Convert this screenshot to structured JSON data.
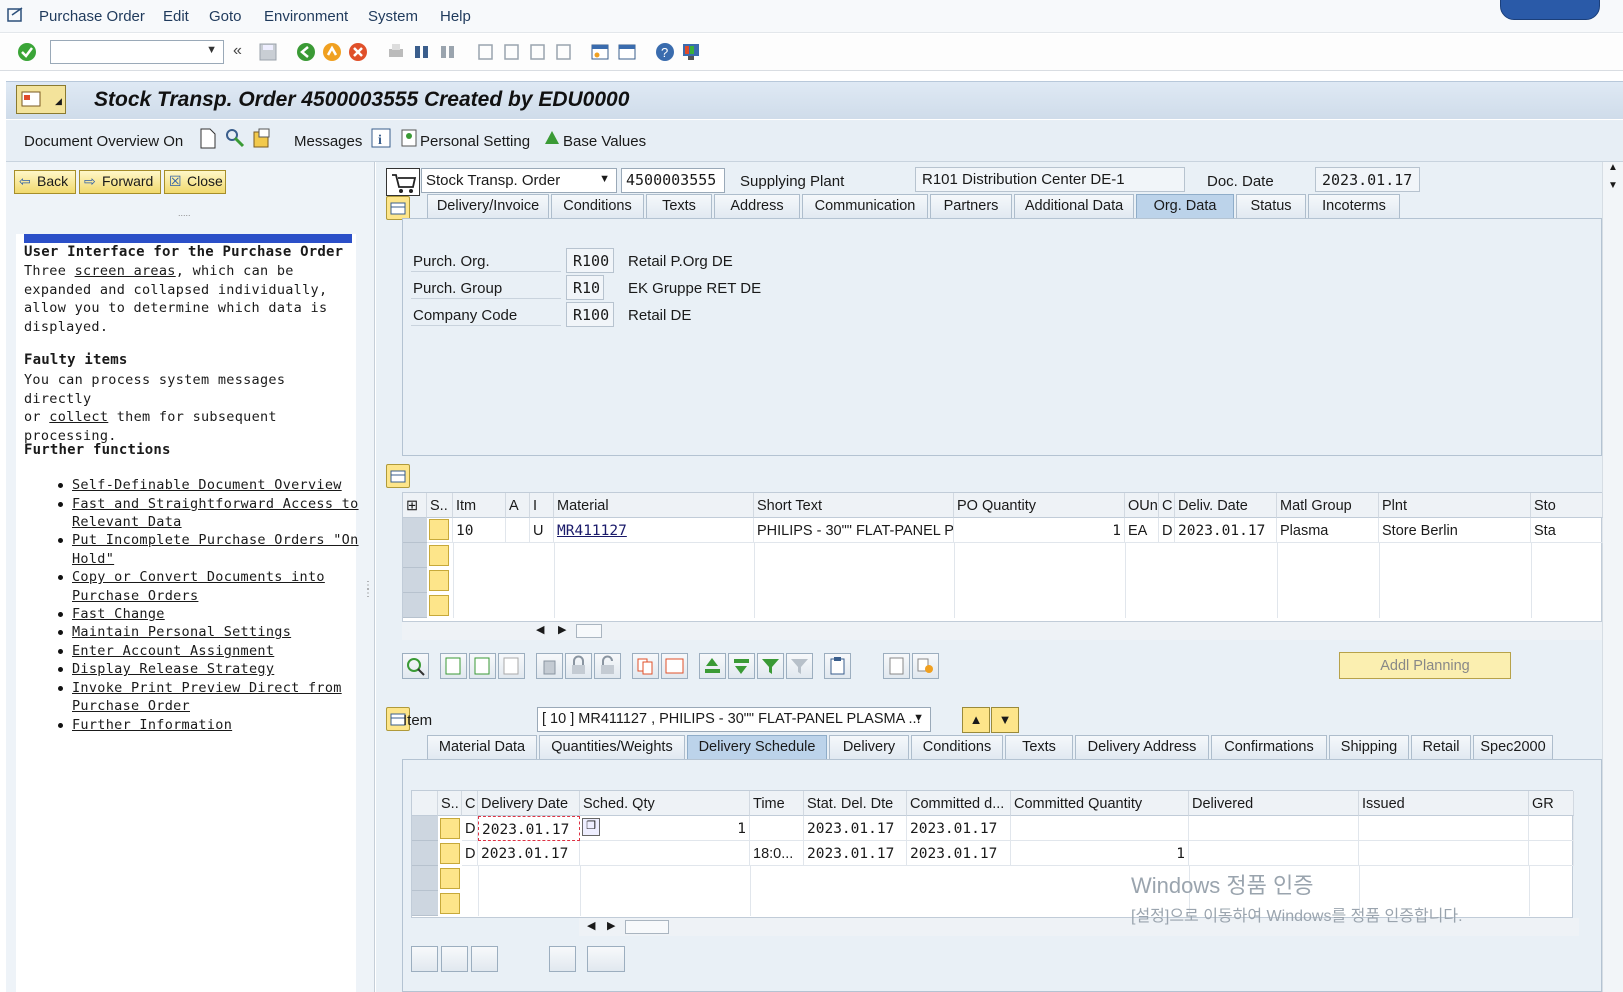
{
  "menubar": {
    "items": [
      "Purchase Order",
      "Edit",
      "Goto",
      "Environment",
      "System",
      "Help"
    ]
  },
  "toolbar": {
    "command_placeholder": ""
  },
  "title": "Stock Transp. Order 4500003555 Created by EDU0000",
  "appbar": {
    "doc_overview": "Document Overview On",
    "messages": "Messages",
    "personal_setting": "Personal Setting",
    "base_values": "Base Values"
  },
  "nav": {
    "back": "Back",
    "forward": "Forward",
    "close": "Close"
  },
  "help": {
    "h1": "User Interface for the Purchase Order",
    "p1a": "Three ",
    "p1link": "screen areas",
    "p1b": ", which can be",
    "p1c": "expanded and collapsed individually,",
    "p1d": "allow you to determine which data is",
    "p1e": "displayed.",
    "h2": "Faulty items",
    "p2a": "You can process system messages directly",
    "p2b": "or ",
    "p2link": "collect",
    "p2c": " them for subsequent",
    "p2d": "processing.",
    "h3": "Further functions",
    "links": [
      "Self-Definable Document Overview",
      "Fast and Straightforward Access to",
      "Relevant Data",
      "Put Incomplete Purchase Orders \"On",
      "Hold\"",
      "Copy or Convert Documents into",
      "Purchase Orders",
      "Fast Change",
      "Maintain Personal Settings",
      "Enter Account Assignment",
      "Display Release Strategy",
      "Invoke Print Preview Direct from",
      "Purchase Order",
      "Further Information"
    ]
  },
  "header": {
    "doc_type": "Stock Transp. Order",
    "doc_number": "4500003555",
    "supplying_plant_label": "Supplying Plant",
    "supplying_plant": "R101 Distribution Center DE-1",
    "doc_date_label": "Doc. Date",
    "doc_date": "2023.01.17"
  },
  "header_tabs": [
    "Delivery/Invoice",
    "Conditions",
    "Texts",
    "Address",
    "Communication",
    "Partners",
    "Additional Data",
    "Org. Data",
    "Status",
    "Incoterms"
  ],
  "org": {
    "purch_org_label": "Purch. Org.",
    "purch_org": "R100",
    "purch_org_desc": "Retail P.Org DE",
    "purch_group_label": "Purch. Group",
    "purch_group": "R10",
    "purch_group_desc": "EK Gruppe RET  DE",
    "company_label": "Company Code",
    "company": "R100",
    "company_desc": "Retail DE"
  },
  "items_grid": {
    "headers": [
      "S..",
      "Itm",
      "A",
      "I",
      "Material",
      "Short Text",
      "PO Quantity",
      "OUn",
      "C",
      "Deliv. Date",
      "Matl Group",
      "Plnt",
      "Sto"
    ],
    "row": {
      "itm": "10",
      "a": "",
      "i": "U",
      "material": "MR411127",
      "short_text": "PHILIPS - 30\"\" FLAT-PANEL P...",
      "qty": "1",
      "oun": "EA",
      "c": "D",
      "deliv_date": "2023.01.17",
      "matl_group": "Plasma",
      "plnt": "Store Berlin",
      "sto": "Sta"
    }
  },
  "addl_planning": "Addl Planning",
  "item_detail": {
    "label": "Item",
    "selected": "[ 10 ] MR411127 , PHILIPS - 30\"\" FLAT-PANEL PLASMA ..."
  },
  "item_tabs": [
    "Material Data",
    "Quantities/Weights",
    "Delivery Schedule",
    "Delivery",
    "Conditions",
    "Texts",
    "Delivery Address",
    "Confirmations",
    "Shipping",
    "Retail",
    "Spec2000"
  ],
  "sched_grid": {
    "headers": [
      "S..",
      "C",
      "Delivery Date",
      "Sched. Qty",
      "Time",
      "Stat. Del. Dte",
      "Committed d...",
      "Committed Quantity",
      "Delivered",
      "Issued",
      "GR"
    ],
    "rows": [
      {
        "c": "D",
        "date": "2023.01.17",
        "qty": "1",
        "time": "",
        "stat": "2023.01.17",
        "comm_d": "2023.01.17",
        "comm_q": ""
      },
      {
        "c": "D",
        "date": "2023.01.17",
        "qty": "",
        "time": "18:0...",
        "stat": "2023.01.17",
        "comm_d": "2023.01.17",
        "comm_q": "1"
      }
    ]
  },
  "watermark": {
    "line1": "Windows 정품 인증",
    "line2": "[설정]으로 이동하여 Windows를 정품 인증합니다."
  }
}
